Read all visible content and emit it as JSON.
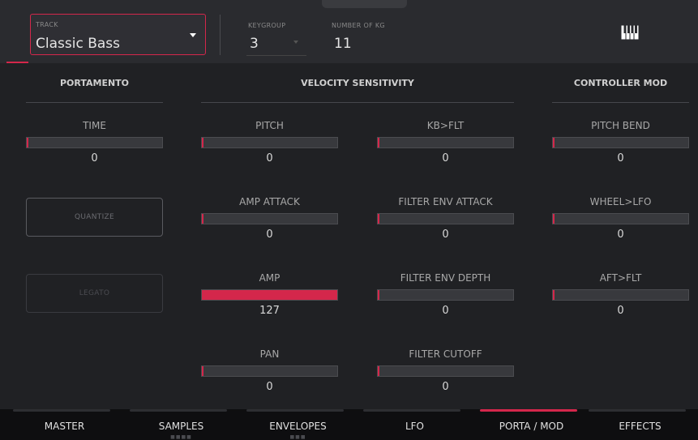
{
  "header": {
    "track_label": "TRACK",
    "track_value": "Classic Bass",
    "keygroup_label": "KEYGROUP",
    "keygroup_value": "3",
    "num_kg_label": "NUMBER OF KG",
    "num_kg_value": "11",
    "keyboard_icon": "piano-keyboard-icon"
  },
  "sections": {
    "portamento": "PORTAMENTO",
    "velocity": "VELOCITY SENSITIVITY",
    "controller": "CONTROLLER MOD"
  },
  "params": {
    "time": {
      "label": "TIME",
      "value": "0",
      "fraction": 0.0
    },
    "pitch": {
      "label": "PITCH",
      "value": "0",
      "fraction": 0.0
    },
    "kb_flt": {
      "label": "KB>FLT",
      "value": "0",
      "fraction": 0.0
    },
    "pitch_bend": {
      "label": "PITCH BEND",
      "value": "0",
      "fraction": 0.0
    },
    "amp_attack": {
      "label": "AMP ATTACK",
      "value": "0",
      "fraction": 0.0
    },
    "filter_env_attack": {
      "label": "FILTER ENV ATTACK",
      "value": "0",
      "fraction": 0.0
    },
    "wheel_lfo": {
      "label": "WHEEL>LFO",
      "value": "0",
      "fraction": 0.0
    },
    "amp": {
      "label": "AMP",
      "value": "127",
      "fraction": 1.0
    },
    "filter_env_depth": {
      "label": "FILTER ENV DEPTH",
      "value": "0",
      "fraction": 0.0
    },
    "aft_flt": {
      "label": "AFT>FLT",
      "value": "0",
      "fraction": 0.0
    },
    "pan": {
      "label": "PAN",
      "value": "0",
      "fraction": 0.0
    },
    "filter_cutoff": {
      "label": "FILTER CUTOFF",
      "value": "0",
      "fraction": 0.0
    }
  },
  "buttons": {
    "quantize": "QUANTIZE",
    "legato": "LEGATO"
  },
  "tabs": [
    {
      "label": "MASTER",
      "active": false
    },
    {
      "label": "SAMPLES",
      "active": false
    },
    {
      "label": "ENVELOPES",
      "active": false
    },
    {
      "label": "LFO",
      "active": false
    },
    {
      "label": "PORTA / MOD",
      "active": true
    },
    {
      "label": "EFFECTS",
      "active": false
    }
  ],
  "colors": {
    "accent": "#d4274b",
    "background": "#202124",
    "header_bg": "#2a2b2f",
    "tabbar_bg": "#0e0e10"
  }
}
